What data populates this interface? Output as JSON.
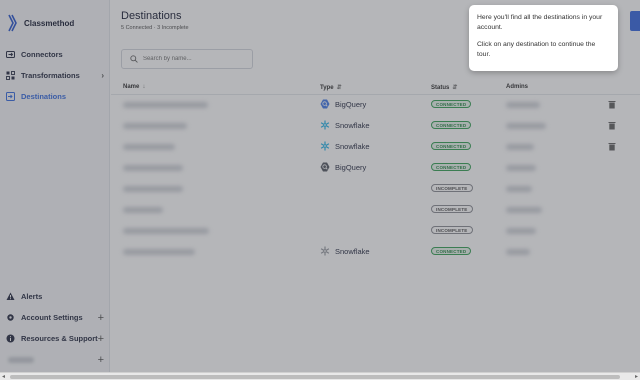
{
  "app": {
    "brand": "Classmethod"
  },
  "sidebar": {
    "items": [
      {
        "label": "Connectors",
        "icon": "connectors-icon"
      },
      {
        "label": "Transformations",
        "icon": "transformations-icon"
      },
      {
        "label": "Destinations",
        "icon": "destinations-icon",
        "active": true
      }
    ],
    "bottom_items": [
      {
        "label": "Alerts",
        "icon": "warning-icon"
      },
      {
        "label": "Account Settings",
        "icon": "gear-icon"
      },
      {
        "label": "Resources & Support",
        "icon": "info-icon"
      }
    ]
  },
  "page": {
    "title": "Destinations",
    "subtitle": "5 Connected · 3 Incomplete"
  },
  "search": {
    "placeholder": "Search by name..."
  },
  "table": {
    "headers": {
      "name": "Name",
      "type": "Type",
      "status": "Status",
      "admins": "Admins"
    },
    "rows": [
      {
        "type": "BigQuery",
        "type_icon": "bigquery-icon",
        "status": "CONNECTED",
        "deletable": true
      },
      {
        "type": "Snowflake",
        "type_icon": "snowflake-icon",
        "status": "CONNECTED",
        "deletable": true
      },
      {
        "type": "Snowflake",
        "type_icon": "snowflake-icon",
        "status": "CONNECTED",
        "deletable": true
      },
      {
        "type": "BigQuery",
        "type_icon": "bigquery-icon",
        "status": "CONNECTED",
        "deletable": false
      },
      {
        "type": "",
        "type_icon": "",
        "status": "INCOMPLETE",
        "deletable": false
      },
      {
        "type": "",
        "type_icon": "",
        "status": "INCOMPLETE",
        "deletable": false
      },
      {
        "type": "",
        "type_icon": "",
        "status": "INCOMPLETE",
        "deletable": false
      },
      {
        "type": "Snowflake",
        "type_icon": "snowflake-icon",
        "status": "CONNECTED",
        "deletable": false
      }
    ]
  },
  "tour": {
    "line1": "Here you'll find all the destinations in your account.",
    "line2": "Click on any destination to continue the tour."
  },
  "colors": {
    "accent": "#3b6fe0",
    "connected": "#2d8a4a",
    "incomplete": "#555555",
    "overlay": "#3c4048"
  }
}
